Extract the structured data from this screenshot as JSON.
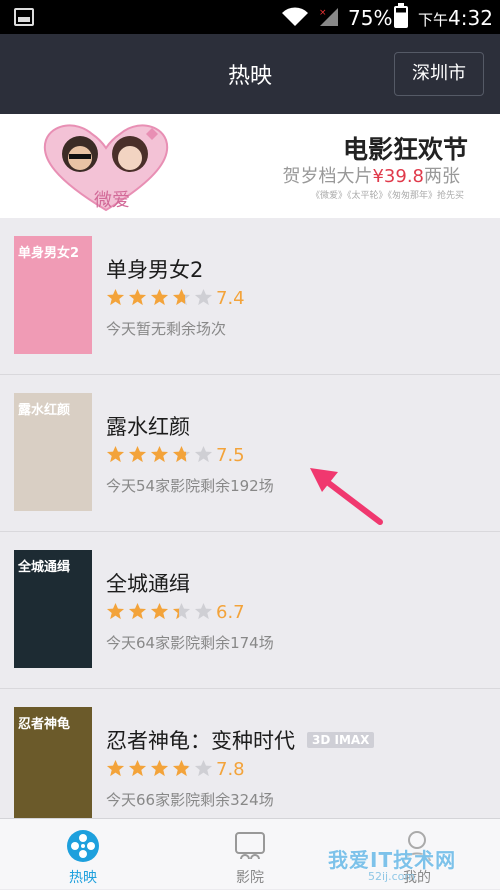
{
  "status_bar": {
    "battery": "75%",
    "time_prefix": "下午",
    "time": "4:32"
  },
  "nav": {
    "title": "热映",
    "city_button": "深圳市"
  },
  "banner": {
    "title": "电影狂欢节",
    "sub_prefix": "贺岁档大片",
    "price": "¥39.8",
    "sub_suffix": "两张",
    "note": "《微爱》《太平轮》《匆匆那年》抢先买",
    "art_text": "微爱"
  },
  "movies": [
    {
      "title": "单身男女2",
      "rating": 7.4,
      "score": "7.4",
      "info": "今天暂无剩余场次",
      "tag": "",
      "poster_text": "单身男女2",
      "poster_bg": "#f09bb5"
    },
    {
      "title": "露水红颜",
      "rating": 7.5,
      "score": "7.5",
      "info": "今天54家影院剩余192场",
      "tag": "",
      "poster_text": "露水红颜",
      "poster_bg": "#d9cfc4"
    },
    {
      "title": "全城通缉",
      "rating": 6.7,
      "score": "6.7",
      "info": "今天64家影院剩余174场",
      "tag": "",
      "poster_text": "全城通缉",
      "poster_bg": "#1d2b33"
    },
    {
      "title": "忍者神龟：变种时代",
      "rating": 7.8,
      "score": "7.8",
      "info": "今天66家影院剩余324场",
      "tag": "3D IMAX",
      "poster_text": "忍者神龟",
      "poster_bg": "#6b5a2a"
    }
  ],
  "tabs": [
    {
      "label": "热映",
      "icon": "film-reel-icon",
      "active": true
    },
    {
      "label": "影院",
      "icon": "cinema-icon",
      "active": false
    },
    {
      "label": "我的",
      "icon": "profile-icon",
      "active": false
    }
  ],
  "watermark": {
    "text": "我爱IT技术网",
    "url": "52ij.com"
  },
  "colors": {
    "accent": "#1ea0dd",
    "star": "#f3a33a",
    "nav_bg": "#2c2f3a",
    "price": "#e03a4b"
  }
}
